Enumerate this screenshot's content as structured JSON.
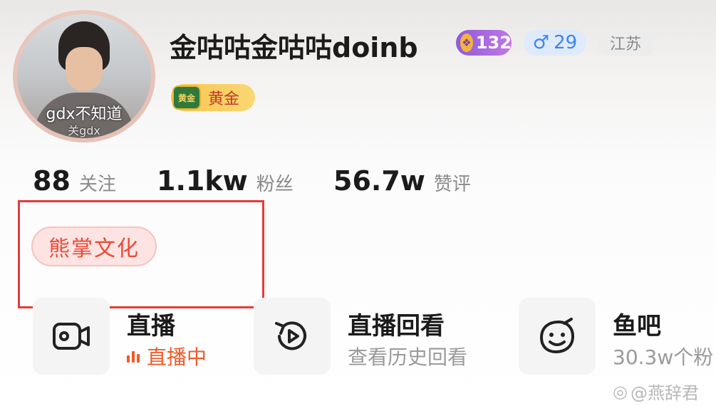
{
  "profile": {
    "avatar_overlay_text": "gdx不知道",
    "avatar_overlay_text2": "关gdx",
    "username": "金咕咕金咕咕doinb",
    "level": "132",
    "gender_symbol": "♂",
    "gender_count": "29",
    "region": "江苏",
    "rank_emblem": "黄金",
    "rank_label": "黄金"
  },
  "stats": [
    {
      "value": "88",
      "label": "关注"
    },
    {
      "value": "1.1kw",
      "label": "粉丝"
    },
    {
      "value": "56.7w",
      "label": "赞评"
    }
  ],
  "tag": "熊掌文化",
  "features": [
    {
      "title": "直播",
      "subtitle": "直播中",
      "icon": "video-camera-icon"
    },
    {
      "title": "直播回看",
      "subtitle": "查看历史回看",
      "icon": "replay-icon"
    },
    {
      "title": "鱼吧",
      "subtitle": "30.3w个粉",
      "icon": "fish-bar-face-icon"
    }
  ],
  "watermark": "@燕辞君",
  "colors": {
    "accent_live": "#f05a28",
    "tag_red": "#e84a3a",
    "annotation_box": "#e53a3a",
    "level_purple": "#8c5bd9",
    "gender_blue": "#3a86f0"
  }
}
